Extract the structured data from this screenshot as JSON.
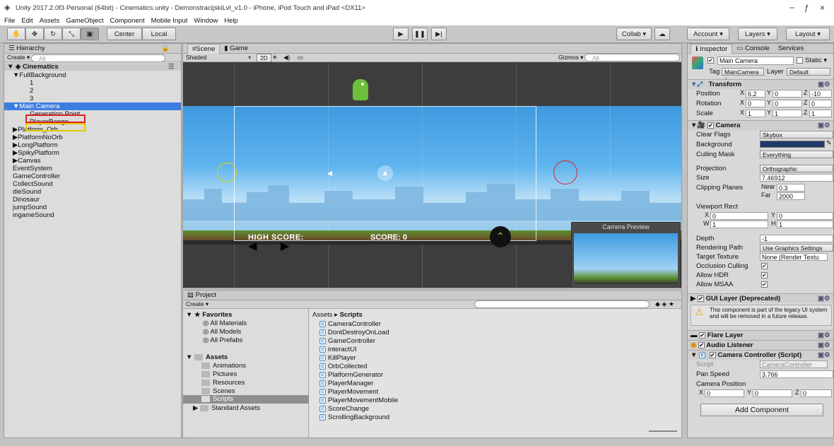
{
  "window": {
    "title": "Unity 2017.2.0f3 Personal (64bit) - Cinematics.unity - DemonstracijskiLvl_v1.0 - iPhone, iPod Touch and iPad <DX11>",
    "minimize": "−",
    "maximize": "ƒ",
    "close": "×"
  },
  "menu": [
    "File",
    "Edit",
    "Assets",
    "GameObject",
    "Component",
    "Mobile Input",
    "Window",
    "Help"
  ],
  "toolbar": {
    "pivot": "Center",
    "space": "Local",
    "collab": "Collab ▾",
    "account": "Account ▾",
    "layers": "Layers ▾",
    "layout": "Layout ▾"
  },
  "hierarchy": {
    "tab": "Hierarchy",
    "create": "Create ▾",
    "search_placeholder": "All",
    "scene_name": "Cinematics",
    "items": [
      {
        "label": "▼FullBackground",
        "indent": 1,
        "selected": false
      },
      {
        "label": "1",
        "indent": 2,
        "selected": false
      },
      {
        "label": "2",
        "indent": 2,
        "selected": false
      },
      {
        "label": "3",
        "indent": 2,
        "selected": false
      },
      {
        "label": "▼Main Camera",
        "indent": 1,
        "selected": true
      },
      {
        "label": "Generation Point",
        "indent": 2,
        "selected": false
      },
      {
        "label": "PlayerRange",
        "indent": 2,
        "selected": false
      },
      {
        "label": "▶Platform_Orb",
        "indent": 1,
        "selected": false
      },
      {
        "label": "▶PlatformNoOrb",
        "indent": 1,
        "selected": false
      },
      {
        "label": "▶LongPlatform",
        "indent": 1,
        "selected": false
      },
      {
        "label": "▶SpikyPlatform",
        "indent": 1,
        "selected": false
      },
      {
        "label": "▶Canvas",
        "indent": 1,
        "selected": false
      },
      {
        "label": "EventSystem",
        "indent": 1,
        "selected": false
      },
      {
        "label": "GameController",
        "indent": 1,
        "selected": false
      },
      {
        "label": "CollectSound",
        "indent": 1,
        "selected": false
      },
      {
        "label": "dieSound",
        "indent": 1,
        "selected": false
      },
      {
        "label": "Dinosaur",
        "indent": 1,
        "selected": false
      },
      {
        "label": "jumpSound",
        "indent": 1,
        "selected": false
      },
      {
        "label": "ingameSound",
        "indent": 1,
        "selected": false
      }
    ]
  },
  "scene": {
    "tab_scene": "Scene",
    "tab_game": "Game",
    "shading": "Shaded",
    "mode_2d": "2D",
    "gizmos": "Gizmos ▾",
    "search_placeholder": "All",
    "high_score": "HIGH SCORE:",
    "score": "SCORE: 0",
    "camera_preview": "Camera Preview"
  },
  "project": {
    "tab": "Project",
    "create": "Create ▾",
    "favorites": "Favorites",
    "favorites_items": [
      "All Materials",
      "All Models",
      "All Prefabs"
    ],
    "assets": "Assets",
    "asset_folders": [
      "Animations",
      "Pictures",
      "Resources",
      "Scenes",
      "Scripts"
    ],
    "standard_assets": "Standard Assets",
    "breadcrumb_root": "Assets",
    "breadcrumb_sep": "▸",
    "breadcrumb_leaf": "Scripts",
    "scripts": [
      "CameraController",
      "DontDestroyOnLoad",
      "GameController",
      "interactUI",
      "KillPlayer",
      "OrbCollected",
      "PlatformGenerator",
      "PlayerManager",
      "PlayerMovement",
      "PlayerMovementMobile",
      "ScoreChange",
      "ScrollingBackground"
    ]
  },
  "inspector": {
    "tab_inspector": "Inspector",
    "tab_console": "Console",
    "tab_services": "Services",
    "object_name": "Main Camera",
    "static_label": "Static ▾",
    "tag_label": "Tag",
    "tag_value": "MainCamera ↕",
    "layer_label": "Layer",
    "layer_value": "Default",
    "transform": {
      "title": "Transform",
      "position_label": "Position",
      "pos_x": "6.2",
      "pos_y": "0",
      "pos_z": "-10",
      "rotation_label": "Rotation",
      "rot_x": "0",
      "rot_y": "0",
      "rot_z": "0",
      "scale_label": "Scale",
      "scl_x": "1",
      "scl_y": "1",
      "scl_z": "1"
    },
    "camera": {
      "title": "Camera",
      "clear_flags_label": "Clear Flags",
      "clear_flags": "Skybox",
      "background_label": "Background",
      "culling_mask_label": "Culling Mask",
      "culling_mask": "Everything",
      "projection_label": "Projection",
      "projection": "Orthographic",
      "size_label": "Size",
      "size": "7.46912",
      "clipping_label": "Clipping Planes",
      "near_label": "Near",
      "near": "0.3",
      "far_label": "Far",
      "far": "2000",
      "viewport_label": "Viewport Rect",
      "vp_x": "0",
      "vp_y": "0",
      "vp_w": "1",
      "vp_h": "1",
      "depth_label": "Depth",
      "depth": "-1",
      "rendering_path_label": "Rendering Path",
      "rendering_path": "Use Graphics Settings",
      "target_texture_label": "Target Texture",
      "target_texture": "None (Render Textu",
      "occlusion_label": "Occlusion Culling",
      "hdr_label": "Allow HDR",
      "msaa_label": "Allow MSAA"
    },
    "gui_layer": {
      "title": "GUI Layer (Deprecated)",
      "warning": "This component is part of the legacy UI system and will be removed in a future release."
    },
    "flare_layer": "Flare Layer",
    "audio_listener": "Audio Listener",
    "camera_controller": {
      "title": "Camera Controller (Script)",
      "script_label": "Script",
      "script_value": "CameraController",
      "pan_speed_label": "Pan Speed",
      "pan_speed": "3.766",
      "camera_position_label": "Camera Position",
      "cp_x": "0",
      "cp_y": "0",
      "cp_z": "0"
    },
    "add_component": "Add Component"
  },
  "colors": {
    "selection": "#3e7de0",
    "sky": "#4fa8e6",
    "highlight_red": "#d22",
    "highlight_yellow": "#e8c800"
  }
}
